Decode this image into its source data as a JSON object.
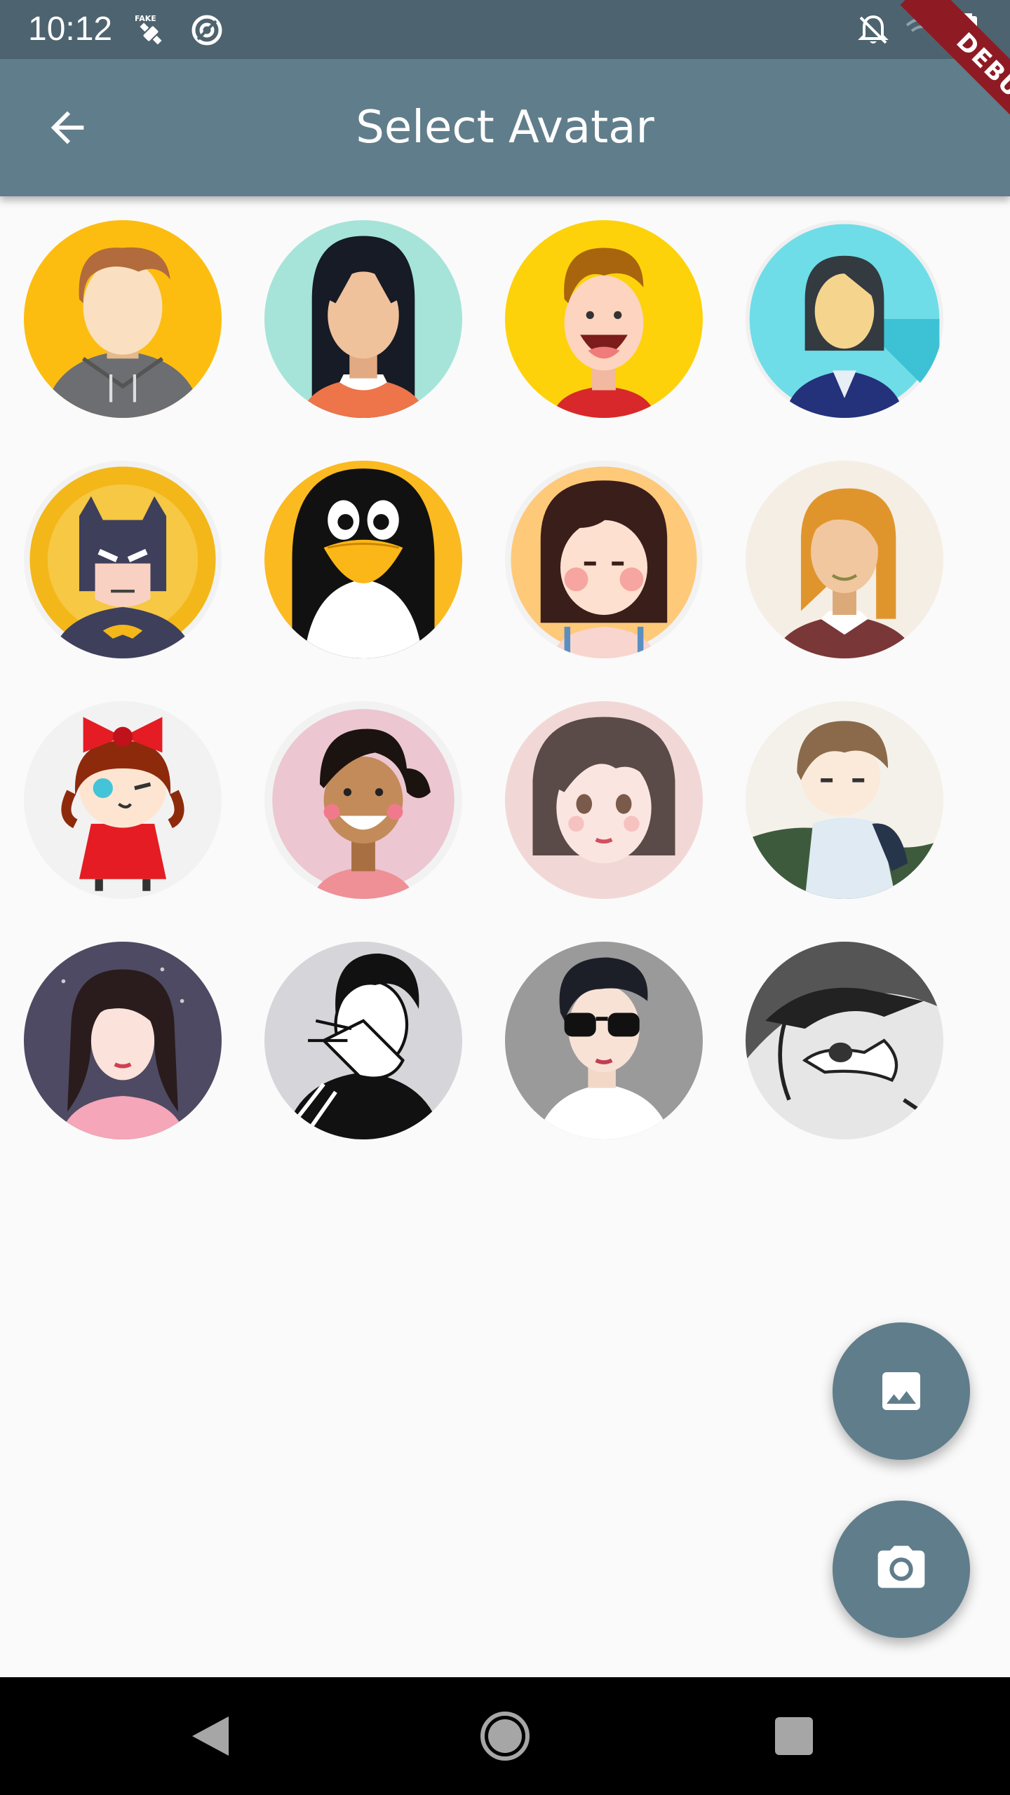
{
  "status_bar": {
    "time": "10:12",
    "icons": [
      "fake-gps-icon",
      "data-saver-icon",
      "notifications-off-icon",
      "wifi-off-icon",
      "battery-charging-icon"
    ]
  },
  "app_bar": {
    "title": "Select Avatar",
    "back_icon": "arrow-back-icon",
    "background": "#607d8b"
  },
  "debug_banner": {
    "label": "DEBUG",
    "color": "#8e1b24"
  },
  "avatars": [
    {
      "name": "avatar-hoodie-man"
    },
    {
      "name": "avatar-black-hair-woman"
    },
    {
      "name": "avatar-laughing-boy"
    },
    {
      "name": "avatar-business-woman"
    },
    {
      "name": "avatar-batman"
    },
    {
      "name": "avatar-penguin"
    },
    {
      "name": "avatar-bangs-girl"
    },
    {
      "name": "avatar-blonde-woman"
    },
    {
      "name": "avatar-bow-girl"
    },
    {
      "name": "avatar-smiling-girl"
    },
    {
      "name": "avatar-anime-girl"
    },
    {
      "name": "avatar-anime-boy"
    },
    {
      "name": "avatar-long-hair-girl"
    },
    {
      "name": "avatar-peace-sign-boy"
    },
    {
      "name": "avatar-sunglasses-boy"
    },
    {
      "name": "avatar-manga-man"
    }
  ],
  "fabs": {
    "gallery_icon": "image-icon",
    "camera_icon": "camera-icon",
    "color": "#607d8b"
  },
  "nav_bar": {
    "buttons": [
      "back-triangle-icon",
      "home-circle-icon",
      "recents-square-icon"
    ]
  }
}
